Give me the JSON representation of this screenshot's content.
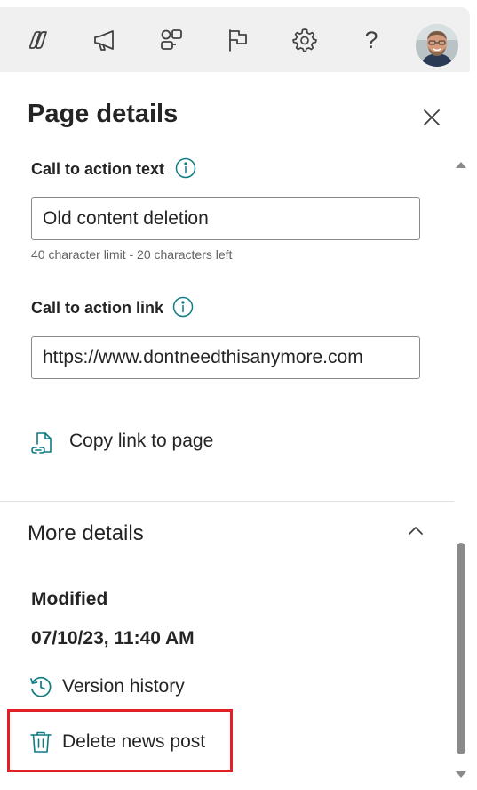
{
  "topbar": {
    "icons": [
      "copilot-icon",
      "megaphone-icon",
      "shapes-icon",
      "flag-icon",
      "gear-icon",
      "help-icon"
    ],
    "help_glyph": "?"
  },
  "panel": {
    "title": "Page details",
    "cta_text": {
      "label": "Call to action text",
      "value": "Old content deletion",
      "hint": "40 character limit - 20 characters left"
    },
    "cta_link": {
      "label": "Call to action link",
      "value": "https://www.dontneedthisanymore.com"
    },
    "copy_link_label": "Copy link to page"
  },
  "more_details": {
    "title": "More details",
    "modified_label": "Modified",
    "modified_value": "07/10/23, 11:40 AM",
    "version_history_label": "Version history",
    "delete_label": "Delete news post"
  },
  "colors": {
    "accent": "#0f7b83",
    "highlight": "#e01f26",
    "topbar_bg": "#f0f0f0"
  }
}
